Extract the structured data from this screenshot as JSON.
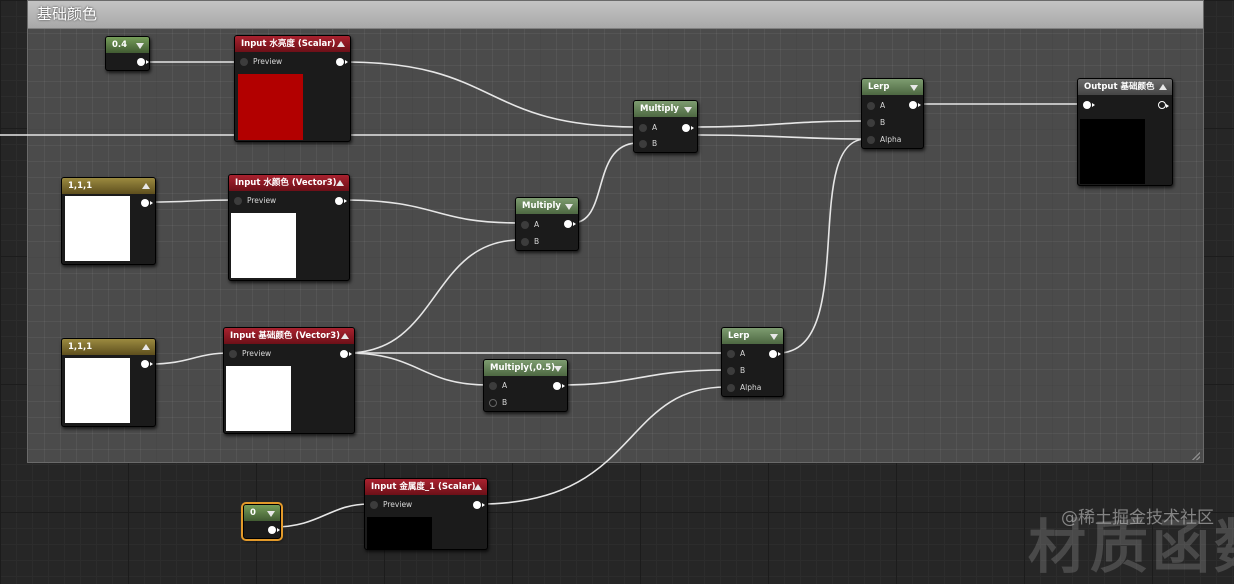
{
  "comment": {
    "title": "基础颜色"
  },
  "nodes": {
    "const_04": {
      "title": "0.4"
    },
    "input_brightness": {
      "title": "Input 水亮度 (Scalar)",
      "preview_label": "Preview",
      "preview_color": "#b20000"
    },
    "multiply_top": {
      "title": "Multiply",
      "pin_a": "A",
      "pin_b": "B"
    },
    "lerp_top": {
      "title": "Lerp",
      "pin_a": "A",
      "pin_b": "B",
      "pin_alpha": "Alpha"
    },
    "output_base": {
      "title": "Output 基础颜色",
      "preview_color": "#000000"
    },
    "const_111_a": {
      "title": "1,1,1",
      "preview_color": "#ffffff"
    },
    "input_water_color": {
      "title": "Input 水颜色 (Vector3)",
      "preview_label": "Preview",
      "preview_color": "#ffffff"
    },
    "multiply_mid": {
      "title": "Multiply",
      "pin_a": "A",
      "pin_b": "B"
    },
    "const_111_b": {
      "title": "1,1,1",
      "preview_color": "#ffffff"
    },
    "input_base_color": {
      "title": "Input 基础颜色 (Vector3)",
      "preview_label": "Preview",
      "preview_color": "#ffffff"
    },
    "multiply_half": {
      "title": "Multiply(,0.5)",
      "pin_a": "A",
      "pin_b": "B"
    },
    "lerp_bottom": {
      "title": "Lerp",
      "pin_a": "A",
      "pin_b": "B",
      "pin_alpha": "Alpha"
    },
    "const_0": {
      "title": "0"
    },
    "input_metallic": {
      "title": "Input 金属度_1 (Scalar)",
      "preview_label": "Preview",
      "preview_color": "#000000"
    }
  },
  "watermark": {
    "text": "@稀土掘金技术社区",
    "big_text": "材质函数"
  },
  "colors": {
    "selection_outline": "#e39a2a",
    "wire": "#e6e6e6"
  }
}
